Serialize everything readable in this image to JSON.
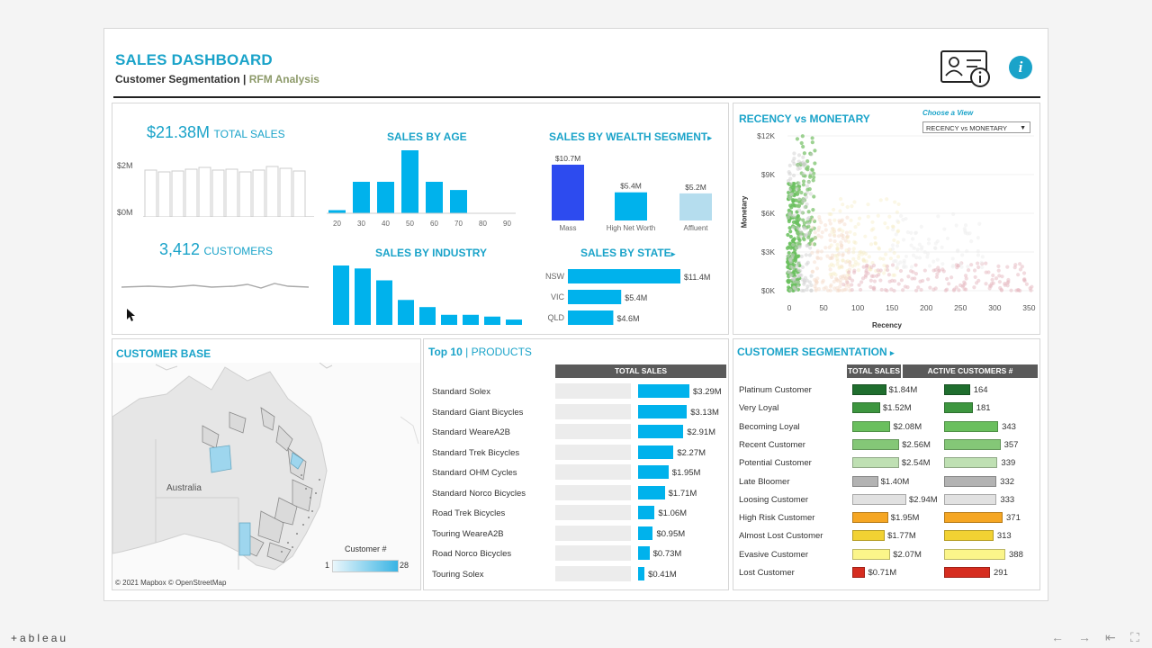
{
  "header": {
    "title": "SALES DASHBOARD",
    "subtitle_main": "Customer Segmentation",
    "subtitle_sep": " | ",
    "subtitle_rfm": "RFM Analysis",
    "info_glyph": "i"
  },
  "kpis": {
    "sales_value": "$21.38M",
    "sales_label": "TOTAL SALES",
    "sales_axis": [
      "$2M",
      "$0M"
    ],
    "customers_value": "3,412",
    "customers_label": "CUSTOMERS"
  },
  "sales_by_age": {
    "title": "SALES BY AGE",
    "categories": [
      "20",
      "30",
      "40",
      "50",
      "60",
      "70",
      "80",
      "90"
    ],
    "values": [
      0.05,
      0.5,
      0.5,
      1.0,
      0.5,
      0.37,
      0,
      0
    ]
  },
  "sales_by_wealth": {
    "title": "SALES BY WEALTH SEGMENT",
    "arrow": "▸",
    "categories": [
      "Mass",
      "High Net Worth",
      "Affluent"
    ],
    "labels": [
      "$10.7M",
      "$5.4M",
      "$5.2M"
    ],
    "values": [
      10.7,
      5.4,
      5.2
    ],
    "colors": [
      "#2d4bef",
      "#00b2ec",
      "#b5ddee"
    ]
  },
  "sales_by_industry": {
    "title": "SALES BY INDUSTRY",
    "values": [
      1.0,
      0.95,
      0.75,
      0.42,
      0.3,
      0.17,
      0.17,
      0.14,
      0.09
    ]
  },
  "sales_by_state": {
    "title": "SALES BY STATE",
    "arrow": "▸",
    "categories": [
      "NSW",
      "VIC",
      "QLD"
    ],
    "labels": [
      "$11.4M",
      "$5.4M",
      "$4.6M"
    ],
    "values": [
      11.4,
      5.4,
      4.6
    ]
  },
  "scatter": {
    "title": "RECENCY vs MONETARY",
    "choose_label": "Choose a View",
    "dropdown_value": "RECENCY vs MONETARY",
    "ylabel": "Monetary",
    "xlabel": "Recency",
    "yticks": [
      "$12K",
      "$9K",
      "$6K",
      "$3K",
      "$0K"
    ],
    "xticks": [
      "0",
      "50",
      "100",
      "150",
      "200",
      "250",
      "300",
      "350"
    ]
  },
  "customer_base": {
    "title": "CUSTOMER BASE",
    "country_label": "Australia",
    "legend_title": "Customer #",
    "legend_min": "1",
    "legend_max": "28",
    "credit": "© 2021 Mapbox  © OpenStreetMap"
  },
  "top10": {
    "title_a": "Top 10",
    "title_sep": " | ",
    "title_b": "PRODUCTS",
    "column_header": "TOTAL SALES",
    "rows": [
      {
        "name": "Standard Solex",
        "label": "$3.29M",
        "value": 3.29
      },
      {
        "name": "Standard Giant Bicycles",
        "label": "$3.13M",
        "value": 3.13
      },
      {
        "name": "Standard WeareA2B",
        "label": "$2.91M",
        "value": 2.91
      },
      {
        "name": "Standard Trek Bicycles",
        "label": "$2.27M",
        "value": 2.27
      },
      {
        "name": "Standard OHM Cycles",
        "label": "$1.95M",
        "value": 1.95
      },
      {
        "name": "Standard Norco Bicycles",
        "label": "$1.71M",
        "value": 1.71
      },
      {
        "name": "Road Trek Bicycles",
        "label": "$1.06M",
        "value": 1.06
      },
      {
        "name": "Touring WeareA2B",
        "label": "$0.95M",
        "value": 0.95
      },
      {
        "name": "Road Norco Bicycles",
        "label": "$0.73M",
        "value": 0.73
      },
      {
        "name": "Touring Solex",
        "label": "$0.41M",
        "value": 0.41
      }
    ]
  },
  "segmentation": {
    "title": "CUSTOMER SEGMENTATION",
    "arrow": "▸",
    "col_sales": "TOTAL SALES",
    "col_active": "ACTIVE CUSTOMERS #",
    "rows": [
      {
        "name": "Platinum Customer",
        "sales_label": "$1.84M",
        "sales": 1.84,
        "cust_label": "164",
        "cust": 164,
        "color": "#1f6e2e"
      },
      {
        "name": "Very Loyal",
        "sales_label": "$1.52M",
        "sales": 1.52,
        "cust_label": "181",
        "cust": 181,
        "color": "#3d963f"
      },
      {
        "name": "Becoming Loyal",
        "sales_label": "$2.08M",
        "sales": 2.08,
        "cust_label": "343",
        "cust": 343,
        "color": "#6abf5e"
      },
      {
        "name": "Recent Customer",
        "sales_label": "$2.56M",
        "sales": 2.56,
        "cust_label": "357",
        "cust": 357,
        "color": "#84c777"
      },
      {
        "name": "Potential Customer",
        "sales_label": "$2.54M",
        "sales": 2.54,
        "cust_label": "339",
        "cust": 339,
        "color": "#bfe0b3"
      },
      {
        "name": "Late Bloomer",
        "sales_label": "$1.40M",
        "sales": 1.4,
        "cust_label": "332",
        "cust": 332,
        "color": "#b3b3b3"
      },
      {
        "name": "Loosing Customer",
        "sales_label": "$2.94M",
        "sales": 2.94,
        "cust_label": "333",
        "cust": 333,
        "color": "#e1e1e1"
      },
      {
        "name": "High Risk Customer",
        "sales_label": "$1.95M",
        "sales": 1.95,
        "cust_label": "371",
        "cust": 371,
        "color": "#f5a623"
      },
      {
        "name": "Almost Lost Customer",
        "sales_label": "$1.77M",
        "sales": 1.77,
        "cust_label": "313",
        "cust": 313,
        "color": "#f2d233"
      },
      {
        "name": "Evasive Customer",
        "sales_label": "$2.07M",
        "sales": 2.07,
        "cust_label": "388",
        "cust": 388,
        "color": "#fbf58a"
      },
      {
        "name": "Lost Customer",
        "sales_label": "$0.71M",
        "sales": 0.71,
        "cust_label": "291",
        "cust": 291,
        "color": "#d62d20"
      }
    ]
  },
  "footer": {
    "brand": "+ableau",
    "nav": [
      "←",
      "→",
      "⇤",
      "⛶"
    ]
  },
  "chart_data": [
    {
      "type": "bar",
      "title": "SALES BY AGE",
      "categories": [
        "20",
        "30",
        "40",
        "50",
        "60",
        "70",
        "80",
        "90"
      ],
      "values": [
        0.05,
        0.5,
        0.5,
        1.0,
        0.5,
        0.37,
        0,
        0
      ]
    },
    {
      "type": "bar",
      "title": "SALES BY WEALTH SEGMENT",
      "categories": [
        "Mass",
        "High Net Worth",
        "Affluent"
      ],
      "values": [
        10.7,
        5.4,
        5.2
      ]
    },
    {
      "type": "bar",
      "title": "SALES BY STATE",
      "categories": [
        "NSW",
        "VIC",
        "QLD"
      ],
      "values": [
        11.4,
        5.4,
        4.6
      ]
    },
    {
      "type": "bar",
      "title": "Top 10 | PRODUCTS",
      "categories": [
        "Standard Solex",
        "Standard Giant Bicycles",
        "Standard WeareA2B",
        "Standard Trek Bicycles",
        "Standard OHM Cycles",
        "Standard Norco Bicycles",
        "Road Trek Bicycles",
        "Touring WeareA2B",
        "Road Norco Bicycles",
        "Touring Solex"
      ],
      "values": [
        3.29,
        3.13,
        2.91,
        2.27,
        1.95,
        1.71,
        1.06,
        0.95,
        0.73,
        0.41
      ]
    },
    {
      "type": "scatter",
      "title": "RECENCY vs MONETARY",
      "xlabel": "Recency",
      "ylabel": "Monetary",
      "xlim": [
        0,
        350
      ],
      "ylim": [
        0,
        12000
      ]
    }
  ]
}
